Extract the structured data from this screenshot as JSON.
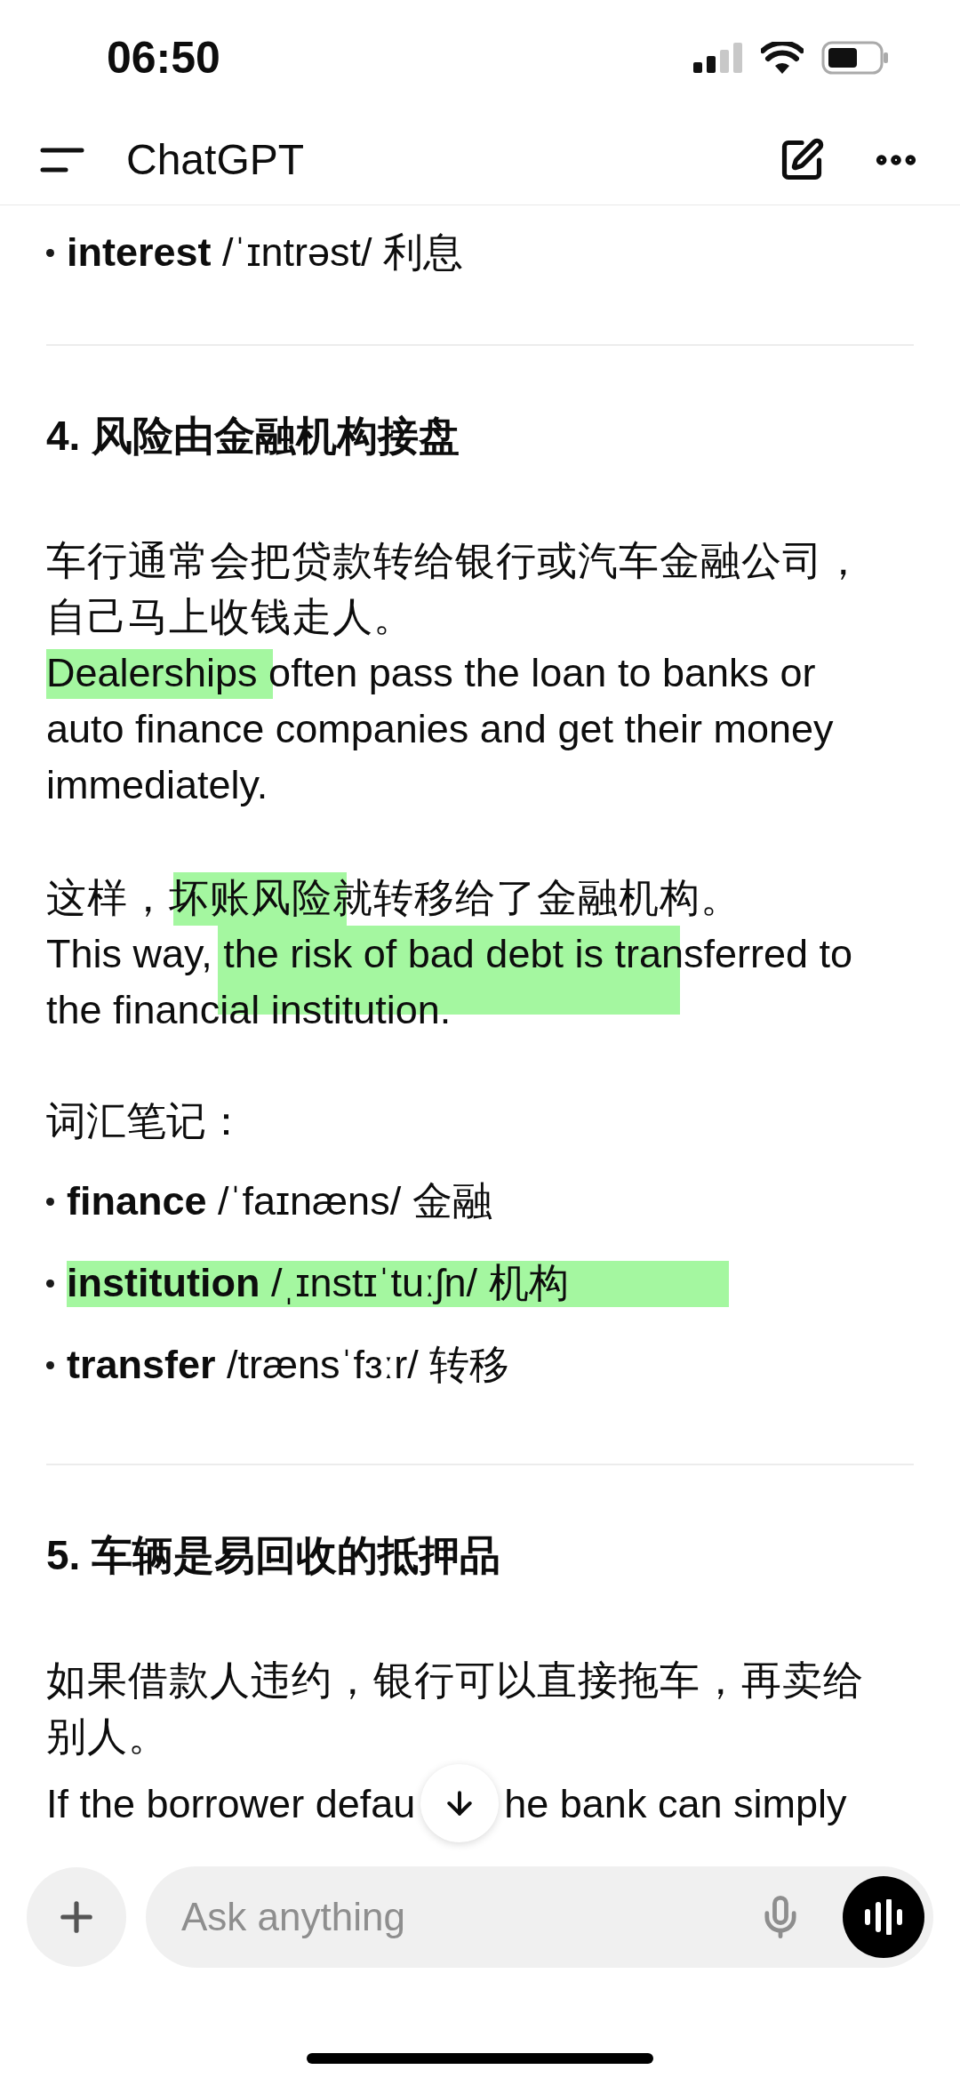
{
  "status_bar": {
    "time": "06:50"
  },
  "header": {
    "title": "ChatGPT"
  },
  "top_vocab": [
    {
      "text": "**interest** /ˈɪntrəst/ 利息"
    }
  ],
  "sections": [
    {
      "heading": "4. 风险由金融机构接盘",
      "paragraphs": [
        {
          "zh": "车行通常会把贷款转给银行或汽车金融公司，自己马上收钱走人。",
          "en": "Dealerships often pass the loan to banks or auto finance companies and get their money immediately."
        },
        {
          "zh": "这样，坏账风险就转移给了金融机构。",
          "en": "This way, the risk of bad debt is transferred to the financial institution."
        }
      ],
      "notes_label": "词汇笔记：",
      "vocab": [
        {
          "text": "**finance** /ˈfaɪnæns/ 金融"
        },
        {
          "text": "**institution** /ˌɪnstɪˈtuːʃn/ 机构"
        },
        {
          "text": "**transfer** /trænsˈfɜːr/ 转移"
        }
      ]
    },
    {
      "heading": "5. 车辆是易回收的抵押品",
      "paragraphs": [
        {
          "zh": "如果借款人违约，银行可以直接拖车，再卖给别人。",
          "en_before": "If the borrower defau",
          "en_after": "he bank can simply"
        }
      ]
    }
  ],
  "composer": {
    "placeholder": "Ask anything"
  }
}
